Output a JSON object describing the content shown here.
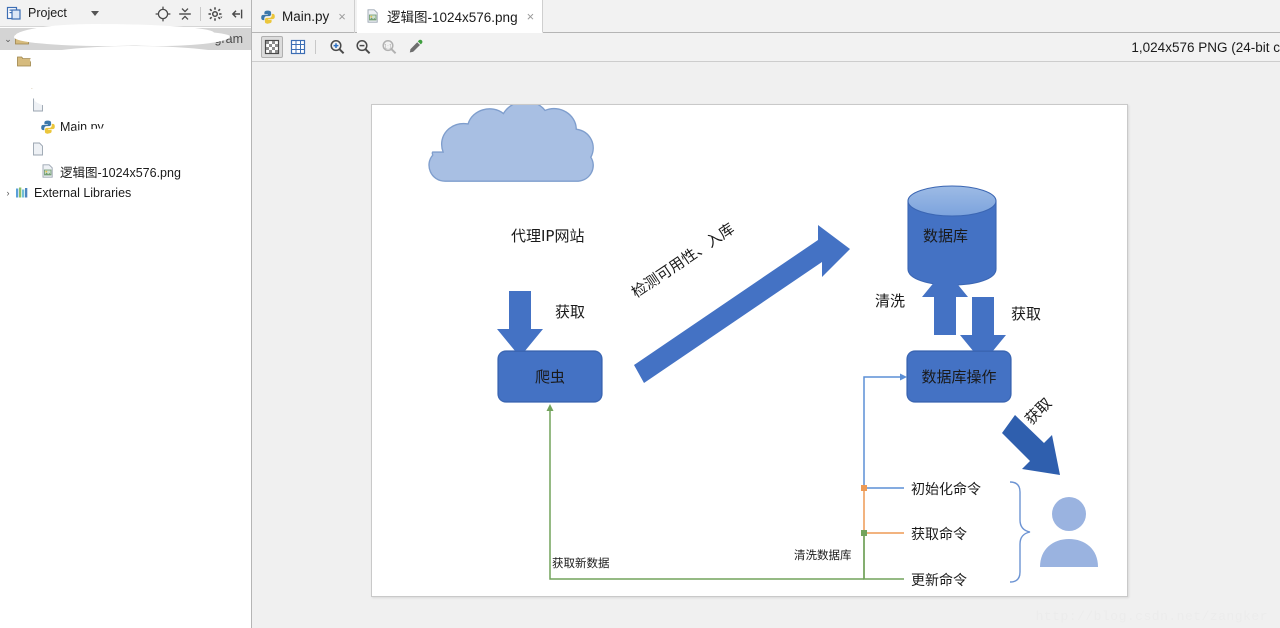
{
  "sidebar": {
    "panel": {
      "title": "Project",
      "icon": "project-icon",
      "chevron": "chevron-down-icon",
      "buttons": [
        {
          "name": "locate-target-icon"
        },
        {
          "name": "collapse-all-icon"
        },
        {
          "name": "settings-gear-icon"
        },
        {
          "name": "hide-panel-icon"
        }
      ]
    },
    "items": [
      {
        "label": "",
        "icon": "folder-icon",
        "selected": true,
        "redacted": true,
        "indent": 0,
        "arrow": "⌄"
      },
      {
        "label": "",
        "icon": "folder-icon",
        "selected": false,
        "redacted": true,
        "indent": 1,
        "arrow": ""
      },
      {
        "label": "",
        "icon": "folder-icon",
        "selected": false,
        "redacted": true,
        "indent": 2,
        "arrow": ""
      },
      {
        "label": "",
        "icon": "file-icon",
        "selected": false,
        "redacted": true,
        "indent": 2,
        "arrow": ""
      },
      {
        "label": "Main.py",
        "icon": "python-file-icon",
        "selected": false,
        "redacted": false,
        "indent": 2,
        "arrow": ""
      },
      {
        "label": "",
        "icon": "file-icon",
        "selected": false,
        "redacted": true,
        "indent": 2,
        "arrow": ""
      },
      {
        "label": "逻辑图-1024x576.png",
        "icon": "image-file-icon",
        "selected": false,
        "redacted": false,
        "indent": 2,
        "arrow": ""
      },
      {
        "label": "External Libraries",
        "icon": "libraries-icon",
        "selected": false,
        "redacted": false,
        "indent": 0,
        "arrow": "›"
      }
    ]
  },
  "tabs": [
    {
      "label": "Main.py",
      "icon": "python-file-icon",
      "active": false,
      "close": "×"
    },
    {
      "label": "逻辑图-1024x576.png",
      "icon": "image-file-icon",
      "active": true,
      "close": "×"
    }
  ],
  "image_toolbar": {
    "buttons": [
      {
        "name": "transparency-grid-toggle",
        "state": "pressed"
      },
      {
        "name": "chessboard-grid-toggle",
        "state": "normal"
      },
      {
        "name": "zoom-in-icon",
        "state": "normal"
      },
      {
        "name": "zoom-out-icon",
        "state": "normal"
      },
      {
        "name": "zoom-actual-size-icon",
        "state": "disabled"
      },
      {
        "name": "color-picker-icon",
        "state": "normal"
      }
    ],
    "info": "1,024x576 PNG (24-bit c"
  },
  "watermark": "http://blog.csdn.net/zangker",
  "diagram": {
    "cloud_label": "代理IP网站",
    "crawler_label": "爬虫",
    "db_label": "数据库",
    "db_op_label": "数据库操作",
    "arrow_fetch_top": "获取",
    "arrow_diagonal": "检测可用性、入库",
    "arrow_clean": "清洗",
    "arrow_fetch_right": "获取",
    "arrow_fetch_user": "获取",
    "cmd_init": "初始化命令",
    "cmd_fetch": "获取命令",
    "cmd_update": "更新命令",
    "label_new_data": "获取新数据",
    "label_clean_db": "清洗数据库",
    "colors": {
      "node_blue": "#4472c4",
      "cloud_blue": "#a8bfe3",
      "arrow_blue": "#4472c4",
      "line_blue": "#5b8fd6",
      "line_orange": "#ed9a55",
      "line_green": "#72a35c",
      "person_blue": "#9ab3e0",
      "brace_blue": "#6d94d3"
    }
  }
}
